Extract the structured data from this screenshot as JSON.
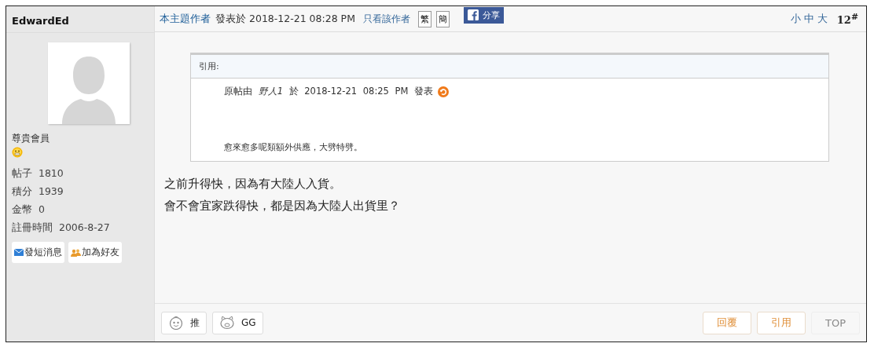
{
  "author": {
    "name": "EdwardEd",
    "rank": "尊貴會員",
    "stats": [
      {
        "label": "帖子",
        "value": "1810"
      },
      {
        "label": "積分",
        "value": "1939"
      },
      {
        "label": "金幣",
        "value": "0"
      },
      {
        "label": "註冊時間",
        "value": "2006-8-27"
      }
    ],
    "actions": [
      {
        "kind": "message",
        "label": "發短消息"
      },
      {
        "kind": "friend",
        "label": "加為好友"
      }
    ]
  },
  "header": {
    "author_link": "本主題作者",
    "posted": "發表於 2018-12-21 08:28 PM",
    "only_author": "只看該作者",
    "lang_buttons": [
      "繁",
      "簡"
    ],
    "share": "分享",
    "font_sizes": [
      "小",
      "中",
      "大"
    ],
    "floor": "12$^{#}$"
  },
  "quote": {
    "title": "引用:",
    "source": "原帖由 *野人1* 於 2018-12-21 08:25 PM 發表",
    "text": "愈來愈多呢類額外供應，大劈特劈。"
  },
  "body": [
    "之前升得快，因為有大陸人入貨。",
    "會不會宜家跌得快，都是因為大陸人出貨里？"
  ],
  "footer": {
    "reactions": [
      {
        "kind": "push",
        "label": "推"
      },
      {
        "kind": "gg",
        "label": "GG"
      }
    ],
    "buttons": [
      {
        "label": "回覆",
        "disabled": false
      },
      {
        "label": "引用",
        "disabled": false
      },
      {
        "label": "TOP",
        "disabled": true
      }
    ]
  }
}
